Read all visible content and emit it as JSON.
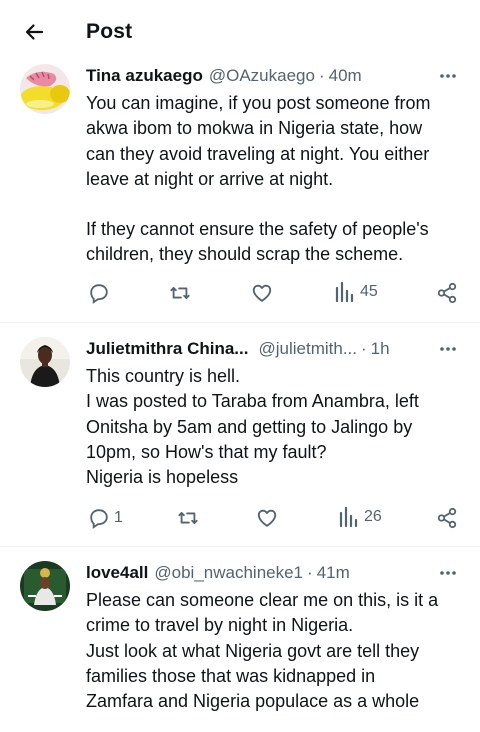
{
  "header": {
    "title": "Post"
  },
  "posts": [
    {
      "name": "Tina azukaego",
      "handle": "@OAzukaego",
      "time": "40m",
      "text": [
        "You can imagine, if you post someone from",
        "akwa ibom to mokwa in Nigeria state, how",
        "can they avoid traveling at night. You either",
        "leave at night or arrive at night.",
        "",
        "If they cannot ensure the safety of people's",
        "children, they should scrap the scheme."
      ],
      "replies": "",
      "views": "45"
    },
    {
      "name": "Julietmithra China...",
      "handle": "@julietmith...",
      "time": "1h",
      "text": [
        "This country is hell.",
        "I was posted to Taraba from Anambra, left",
        "Onitsha by 5am and getting to Jalingo by",
        "10pm, so How's that my fault?",
        "Nigeria is hopeless"
      ],
      "replies": "1",
      "views": "26"
    },
    {
      "name": "love4all",
      "handle": "@obi_nwachineke1",
      "time": "41m",
      "text": [
        "Please can someone clear me on this, is it a",
        "crime to travel by night in Nigeria.",
        "Just look at what Nigeria govt are tell they",
        "families those that was kidnapped in",
        "Zamfara and Nigeria populace as a whole"
      ]
    }
  ],
  "separator": "·",
  "icons": [
    "back-arrow-icon",
    "more-icon",
    "reply-icon",
    "repost-icon",
    "like-icon",
    "views-icon",
    "share-icon"
  ]
}
